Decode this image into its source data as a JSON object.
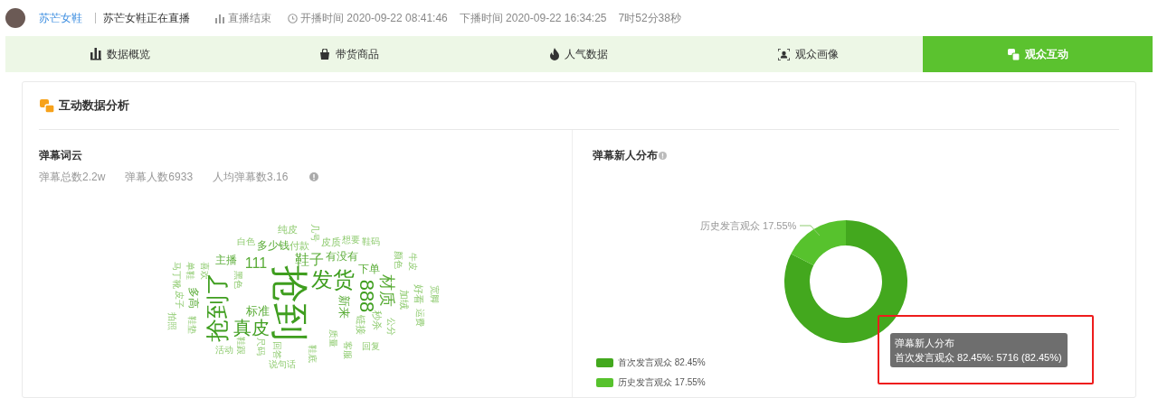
{
  "header": {
    "shop_name": "苏芒女鞋",
    "live_title": "苏芒女鞋正在直播",
    "status": "直播结束",
    "start_time": "开播时间 2020-09-22 08:41:46",
    "end_time": "下播时间 2020-09-22 16:34:25",
    "duration": "7时52分38秒"
  },
  "tabs": [
    {
      "label": "数据概览",
      "selected": false
    },
    {
      "label": "带货商品",
      "selected": false
    },
    {
      "label": "人气数据",
      "selected": false
    },
    {
      "label": "观众画像",
      "selected": false
    },
    {
      "label": "观众互动",
      "selected": true
    }
  ],
  "card": {
    "title": "互动数据分析"
  },
  "word_cloud_panel": {
    "title": "弹幕词云",
    "stats": [
      "弹幕总数2.2w",
      "弹幕人数6933",
      "人均弹幕数3.16"
    ],
    "words": [
      "纯皮",
      "几号",
      "白色",
      "多少钱",
      "付款",
      "皮质",
      "想要",
      "鞋码",
      "马丁靴",
      "单鞋",
      "喜欢",
      "主播",
      "111",
      "鞋子",
      "有没有",
      "下单",
      "颜色",
      "牛皮",
      "抢到",
      "发货",
      "黑色",
      "抢到了",
      "材质",
      "888",
      "好看",
      "宽脚",
      "皮子",
      "多高",
      "加绒",
      "新来",
      "标准",
      "运费",
      "拍照",
      "秒杀",
      "链接",
      "鞋垫",
      "公分",
      "真皮",
      "质量",
      "鞋跟",
      "尺码",
      "客服",
      "回答",
      "回复",
      "鞋底",
      "活动",
      "说句话"
    ]
  },
  "distribution_panel": {
    "title": "弹幕新人分布",
    "chart_data": {
      "type": "donut",
      "categories": [
        "首次发言观众 82.45%",
        "历史发言观众 17.55%"
      ],
      "values": [
        82.45,
        17.55
      ]
    },
    "legend": [
      {
        "color": "#43a81e"
      },
      {
        "color": "#57c22d"
      }
    ],
    "tooltip": {
      "title": "弹幕新人分布",
      "text": "首次发言观众 82.45%: 5716 (82.45%)",
      "highlighted": true
    }
  }
}
